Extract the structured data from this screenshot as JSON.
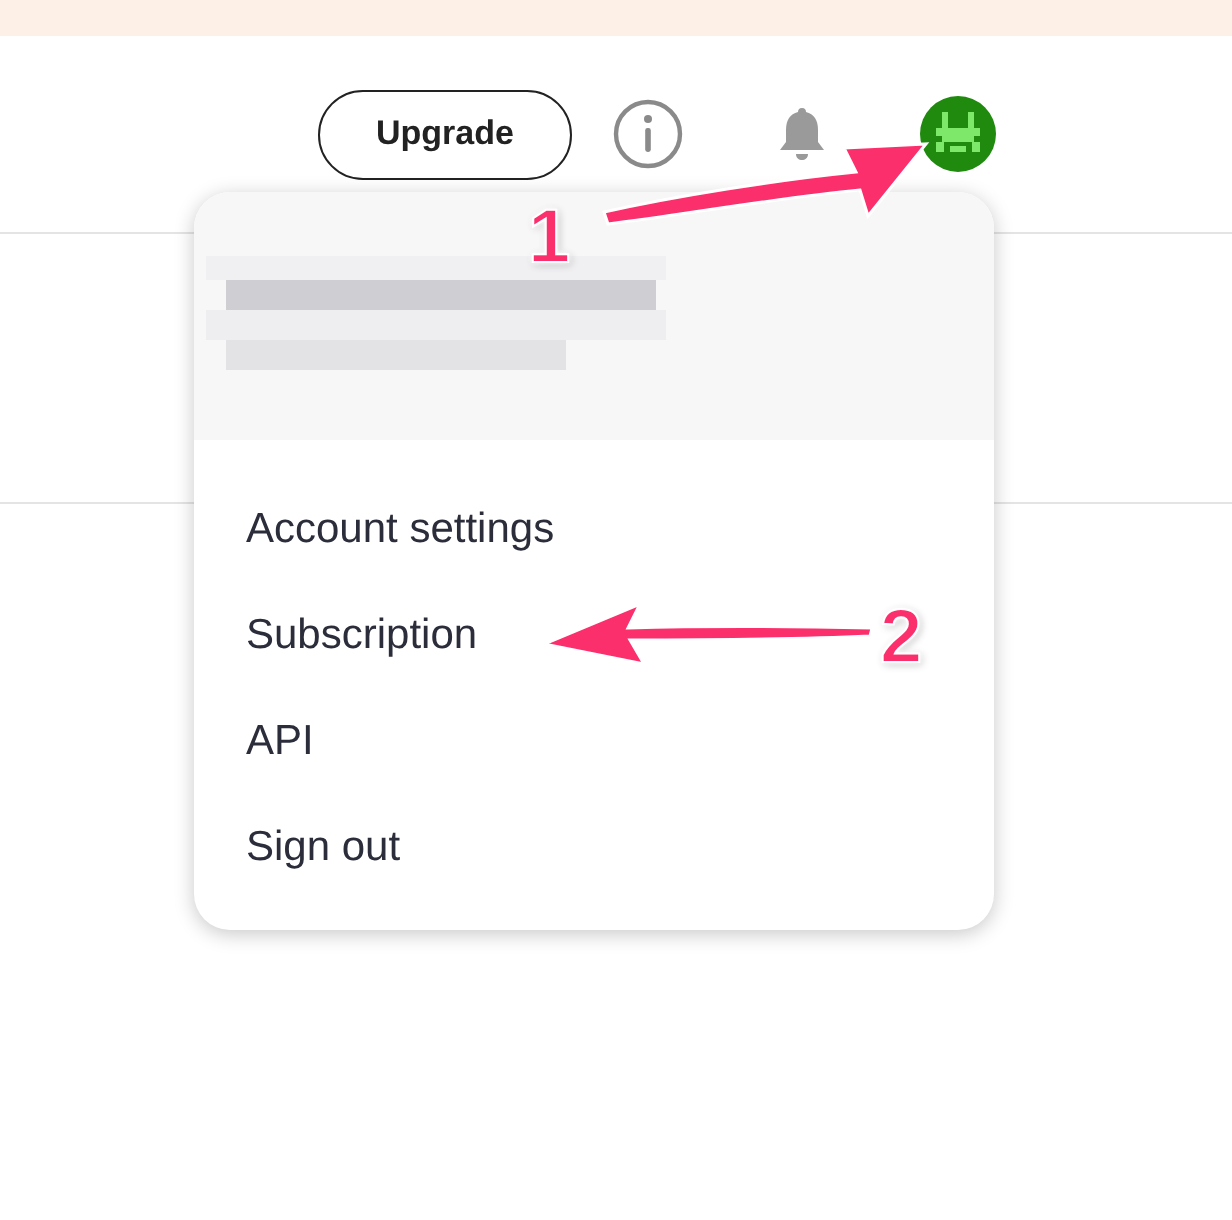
{
  "header": {
    "upgrade_button": "Upgrade"
  },
  "user_menu": {
    "items": [
      {
        "label": "Account settings"
      },
      {
        "label": "Subscription"
      },
      {
        "label": "API"
      },
      {
        "label": "Sign out"
      }
    ]
  },
  "annotations": [
    {
      "number": "1"
    },
    {
      "number": "2"
    }
  ]
}
